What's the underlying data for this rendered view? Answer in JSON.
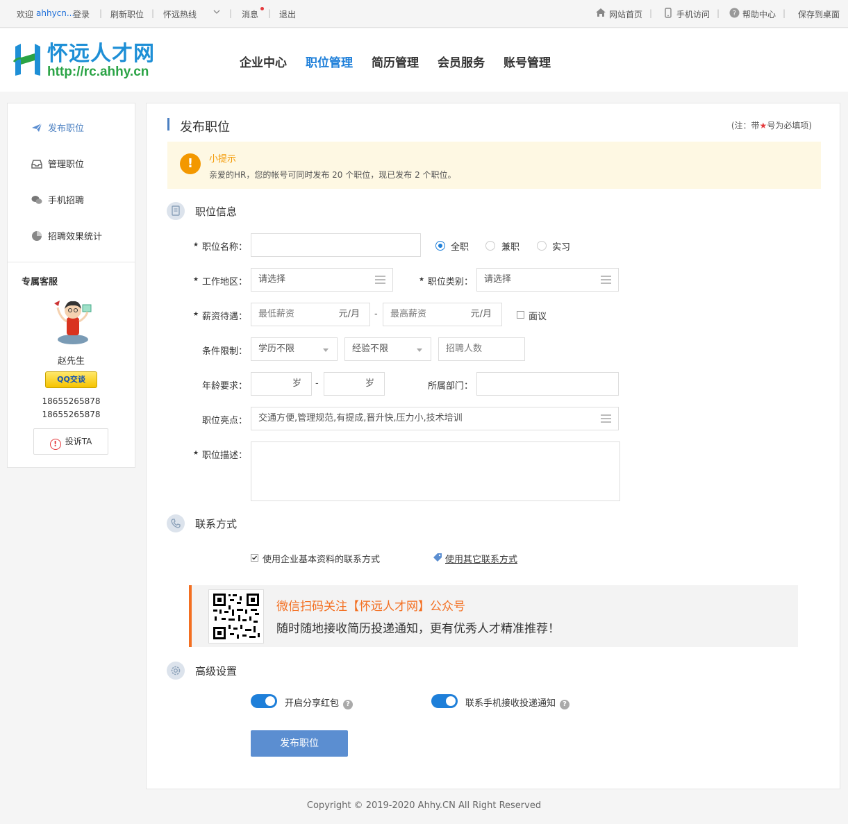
{
  "topbar": {
    "welcome": "欢迎",
    "username": "ahhycn...",
    "login": "登录",
    "refresh": "刷新职位",
    "hotline": "怀远热线",
    "messages": "消息",
    "logout": "退出",
    "home": "网站首页",
    "mobile": "手机访问",
    "help": "帮助中心",
    "save_desktop": "保存到桌面"
  },
  "header": {
    "logo_name": "怀远人才网",
    "logo_url": "http://rc.ahhy.cn",
    "nav": [
      "企业中心",
      "职位管理",
      "简历管理",
      "会员服务",
      "账号管理"
    ],
    "active_nav_index": 1
  },
  "sidebar": {
    "items": [
      "发布职位",
      "管理职位",
      "手机招聘",
      "招聘效果统计"
    ],
    "icons": [
      "paper-plane-icon",
      "inbox-icon",
      "wechat-icon",
      "pie-chart-icon"
    ],
    "active_index": 0,
    "service_title": "专属客服",
    "service_name": "赵先生",
    "qq_label": "QQ交谈",
    "phone1": "18655265878",
    "phone2": "18655265878",
    "complain": "投诉TA"
  },
  "main": {
    "title": "发布职位",
    "note_prefix": "(注：带",
    "note_star": "★",
    "note_suffix": "号为必填项)",
    "tip_title": "小提示",
    "tip_text": "亲爱的HR，您的帐号可同时发布 20 个职位，现已发布 2 个职位。",
    "section_job": "职位信息",
    "section_contact": "联系方式",
    "section_advanced": "高级设置",
    "star": "★"
  },
  "form": {
    "job_name_label": "职位名称：",
    "job_name_value": "",
    "type_options": [
      "全职",
      "兼职",
      "实习"
    ],
    "type_selected": "全职",
    "area_label": "工作地区：",
    "area_value": "请选择",
    "category_label": "职位类别：",
    "category_value": "请选择",
    "salary_label": "薪资待遇：",
    "salary_min_placeholder": "最低薪资",
    "salary_max_placeholder": "最高薪资",
    "salary_unit": "元/月",
    "salary_dash": "-",
    "negotiable": "面议",
    "negotiable_checked": false,
    "conditions_label": "条件限制：",
    "education": "学历不限",
    "experience": "经验不限",
    "headcount_placeholder": "招聘人数",
    "age_label": "年龄要求：",
    "age_unit": "岁",
    "age_dash": "-",
    "department_label": "所属部门：",
    "department_value": "",
    "highlights_label": "职位亮点：",
    "highlights_value": "交通方便,管理规范,有提成,晋升快,压力小,技术培训",
    "description_label": "职位描述：",
    "description_value": ""
  },
  "contact": {
    "use_company": "使用企业基本资料的联系方式",
    "use_company_checked": true,
    "use_other": "使用其它联系方式"
  },
  "wechat": {
    "line1": "微信扫码关注【怀远人才网】公众号",
    "line2": "随时随地接收简历投递通知，更有优秀人才精准推荐！"
  },
  "advanced": {
    "share_redpacket": "开启分享红包",
    "share_redpacket_on": true,
    "sms_notify": "联系手机接收投递通知",
    "sms_notify_on": true,
    "help_mark": "?"
  },
  "submit_label": "发布职位",
  "footer": "Copyright © 2019-2020 Ahhy.CN All Right Reserved",
  "colors": {
    "accent": "#1e7fd9",
    "star": "#e4393c",
    "tip": "#f39800",
    "wechat_accent": "#f36f21",
    "submit": "#5b8ed1"
  }
}
